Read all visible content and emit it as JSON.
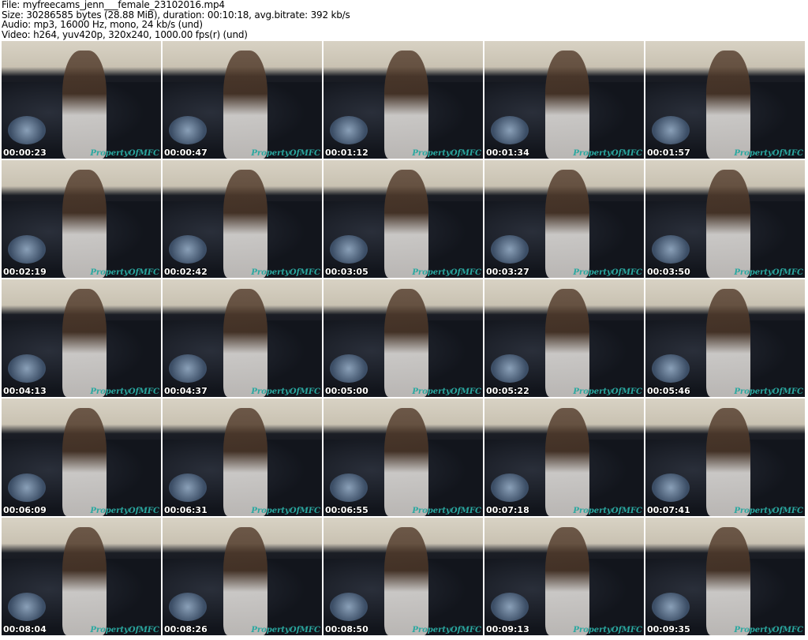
{
  "header": {
    "file": "File: myfreecams_jenn___female_23102016.mp4",
    "size": "Size: 30286585 bytes (28.88 MiB), duration: 00:10:18, avg.bitrate: 392 kb/s",
    "audio": "Audio: mp3, 16000 Hz, mono, 24 kb/s (und)",
    "video": "Video: h264, yuv420p, 320x240, 1000.00 fps(r) (und)"
  },
  "watermark": "PropertyOfMFC",
  "thumbnails": [
    "00:00:23",
    "00:00:47",
    "00:01:12",
    "00:01:34",
    "00:01:57",
    "00:02:19",
    "00:02:42",
    "00:03:05",
    "00:03:27",
    "00:03:50",
    "00:04:13",
    "00:04:37",
    "00:05:00",
    "00:05:22",
    "00:05:46",
    "00:06:09",
    "00:06:31",
    "00:06:55",
    "00:07:18",
    "00:07:41",
    "00:08:04",
    "00:08:26",
    "00:08:50",
    "00:09:13",
    "00:09:35"
  ]
}
